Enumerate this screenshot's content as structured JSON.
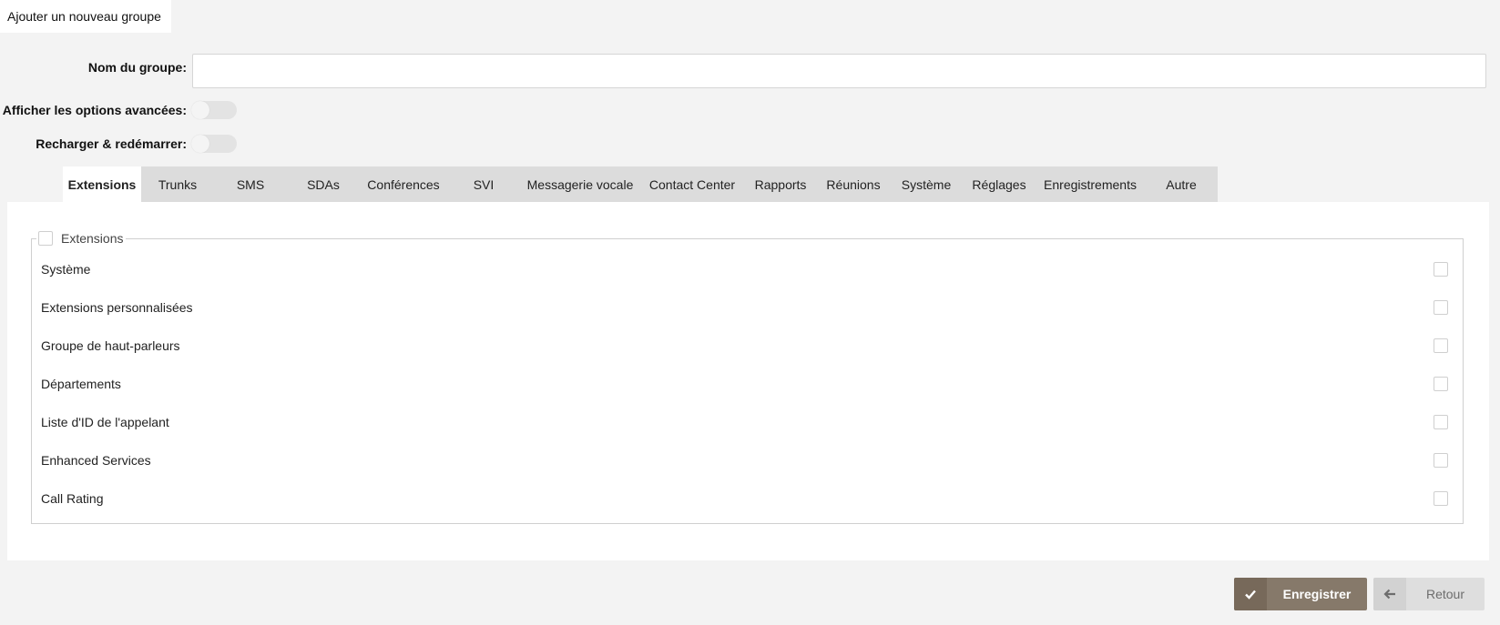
{
  "page_tab": "Ajouter un nouveau groupe",
  "form": {
    "group_name_label": "Nom du groupe:",
    "group_name_value": "",
    "advanced_label": "Afficher les options avancées:",
    "reload_label": "Recharger & redémarrer:"
  },
  "tabs": [
    "Extensions",
    "Trunks",
    "SMS",
    "SDAs",
    "Conférences",
    "SVI",
    "Messagerie vocale",
    "Contact Center",
    "Rapports",
    "Réunions",
    "Système",
    "Réglages",
    "Enregistrements",
    "Autre"
  ],
  "panel": {
    "legend": "Extensions",
    "rows": [
      "Système",
      "Extensions personnalisées",
      "Groupe de haut-parleurs",
      "Départements",
      "Liste d'ID de l'appelant",
      "Enhanced Services",
      "Call Rating"
    ]
  },
  "buttons": {
    "save": "Enregistrer",
    "back": "Retour"
  },
  "colors": {
    "save_bg": "#86796a",
    "back_bg": "#dedede",
    "tab_bg": "#dcdcdc"
  }
}
